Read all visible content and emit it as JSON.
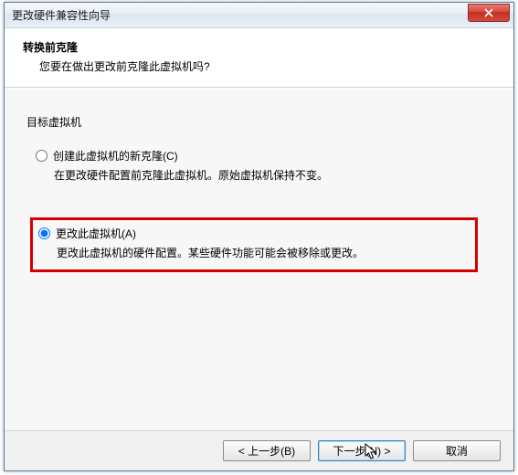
{
  "window": {
    "title": "更改硬件兼容性向导"
  },
  "header": {
    "title": "转换前克隆",
    "subtitle": "您要在做出更改前克隆此虚拟机吗?"
  },
  "section_label": "目标虚拟机",
  "options": {
    "clone": {
      "label": "创建此虚拟机的新克隆(C)",
      "desc": "在更改硬件配置前克隆此虚拟机。原始虚拟机保持不变。"
    },
    "alter": {
      "label": "更改此虚拟机(A)",
      "desc": "更改此虚拟机的硬件配置。某些硬件功能可能会被移除或更改。"
    }
  },
  "footer": {
    "back": "< 上一步(B)",
    "next": "下一步(N) >",
    "cancel": "取消"
  }
}
